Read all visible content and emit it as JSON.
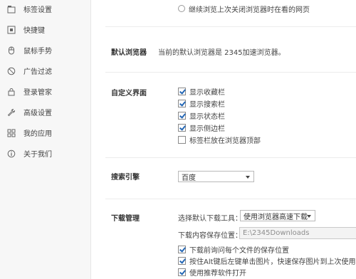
{
  "sidebar": {
    "items": [
      {
        "label": "标签设置",
        "icon": "tab-icon"
      },
      {
        "label": "快捷键",
        "icon": "keyboard-icon"
      },
      {
        "label": "鼠标手势",
        "icon": "mouse-icon"
      },
      {
        "label": "广告过滤",
        "icon": "block-icon"
      },
      {
        "label": "登录管家",
        "icon": "lock-icon"
      },
      {
        "label": "高级设置",
        "icon": "wrench-icon"
      },
      {
        "label": "我的应用",
        "icon": "apps-icon"
      },
      {
        "label": "关于我们",
        "icon": "info-icon"
      }
    ]
  },
  "startup": {
    "restore_option": "继续浏览上次关闭浏览器时在看的网页"
  },
  "default_browser": {
    "label": "默认浏览器",
    "status": "当前的默认浏览器是 2345加速浏览器。"
  },
  "custom_ui": {
    "label": "自定义界面",
    "options": [
      {
        "label": "显示收藏栏",
        "checked": true
      },
      {
        "label": "显示搜索栏",
        "checked": true
      },
      {
        "label": "显示状态栏",
        "checked": true
      },
      {
        "label": "显示侧边栏",
        "checked": true
      },
      {
        "label": "标签栏放在浏览器顶部",
        "checked": false
      }
    ]
  },
  "search_engine": {
    "label": "搜索引擎",
    "selected": "百度"
  },
  "download": {
    "label": "下载管理",
    "tool_label": "选择默认下载工具：",
    "tool_selected": "使用浏览器高速下载",
    "path_label": "下载内容保存位置：",
    "path_value": "E:\\2345Downloads",
    "options": [
      {
        "label": "下载前询问每个文件的保存位置",
        "checked": true
      },
      {
        "label": "按住Alt键后左键单击图片，快速保存图片到上次使用的文",
        "checked": true
      },
      {
        "label": "使用推荐软件打开",
        "checked": true
      }
    ]
  },
  "colors": {
    "accent": "#2467b5",
    "sidebar_bg": "#f7f7f7",
    "divider": "#ececec"
  }
}
